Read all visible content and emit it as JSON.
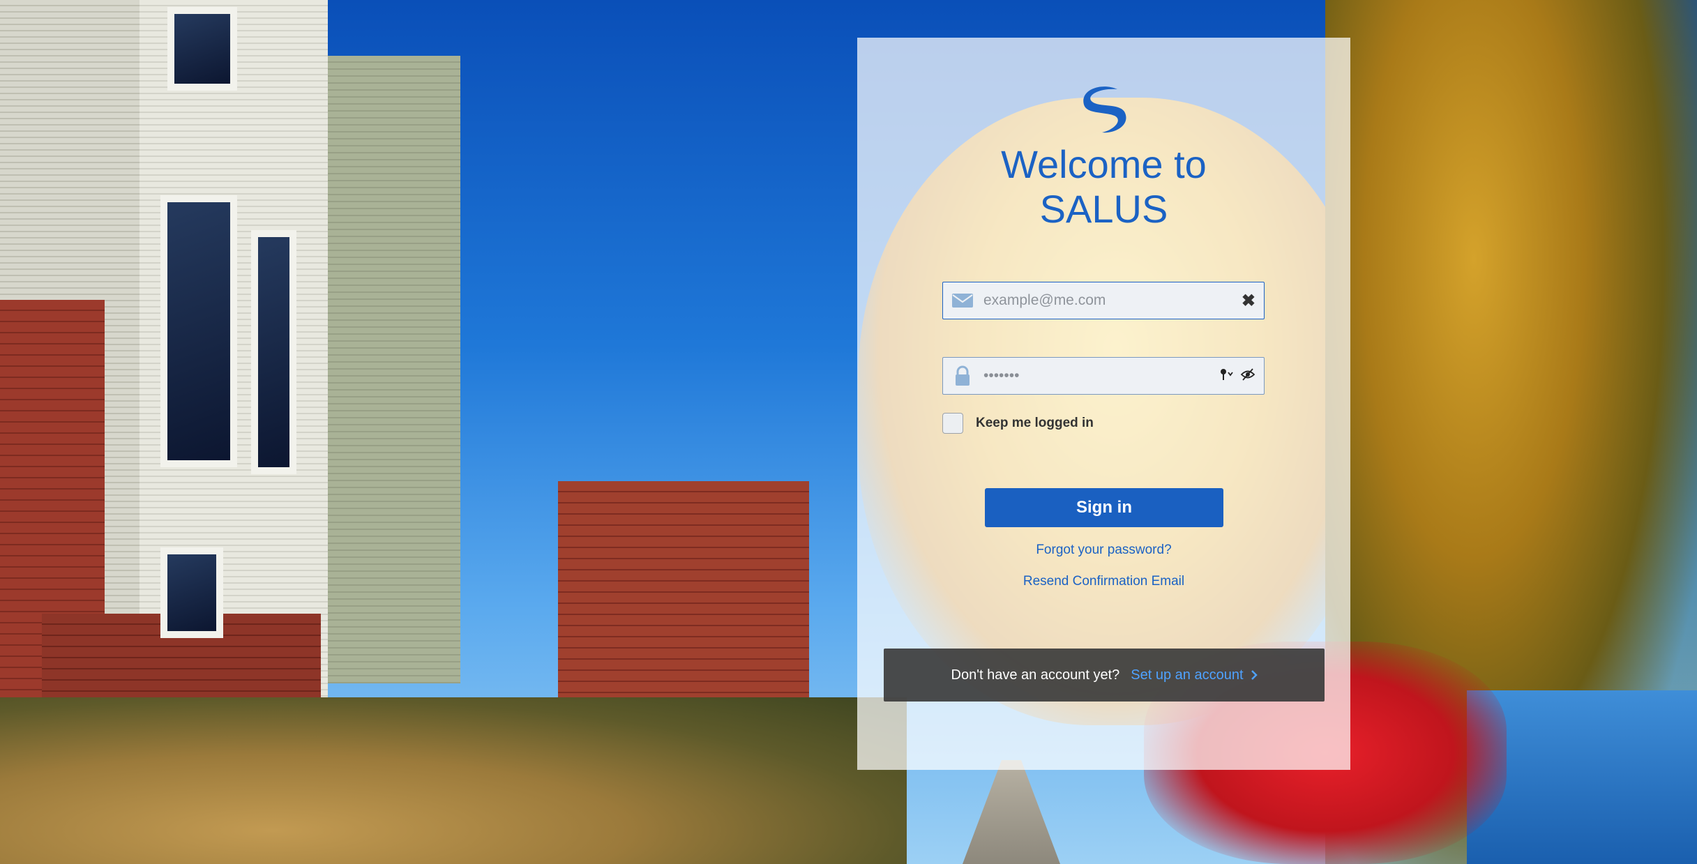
{
  "login": {
    "welcome_line1": "Welcome to",
    "welcome_line2": "SALUS",
    "email_placeholder": "example@me.com",
    "password_value": "•••••••",
    "keep_logged_in_label": "Keep me logged in",
    "keep_logged_in_checked": false,
    "signin_label": "Sign in",
    "forgot_password_link": "Forgot your password?",
    "resend_confirmation_link": "Resend Confirmation Email",
    "signup_question": "Don't have an account yet?",
    "signup_link": "Set up an account"
  },
  "icons": {
    "logo": "salus-swirl-logo",
    "email": "envelope-icon",
    "password": "lock-icon",
    "clear": "close-icon",
    "key": "key-icon",
    "reveal": "eye-slash-icon",
    "chevron": "chevron-right-icon"
  },
  "colors": {
    "brand_blue": "#1b62c4",
    "button_blue": "#1a60c1",
    "link_blue": "#4fa2ff",
    "signup_bar": "#3c3c3c"
  }
}
